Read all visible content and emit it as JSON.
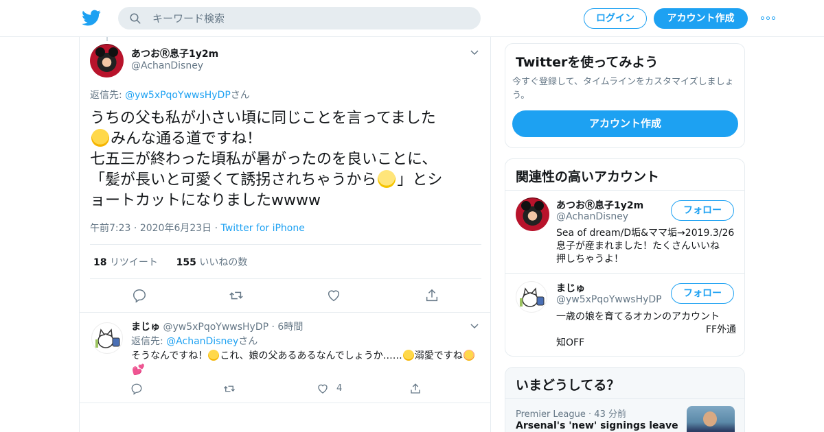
{
  "header": {
    "search_placeholder": "キーワード検索",
    "login_label": "ログイン",
    "signup_label": "アカウント作成"
  },
  "tweet": {
    "author_name": "あつおⓇ息子1y2m",
    "author_handle": "@AchanDisney",
    "reply_prefix": "返信先: ",
    "reply_to": "@yw5xPqoYwwsHyDP",
    "reply_suffix": "さん",
    "text_lines": [
      "うちの父も私が小さい頃に同じことを言ってました",
      "みんな通る道ですね！",
      "七五三が終わった頃私が暑がったのを良いことに、",
      "「髪が長いと可愛くて誘拐されちゃうから",
      "」とシ",
      "ョートカットになりましたwwww"
    ],
    "time": "午前7:23",
    "date": "2020年6月23日",
    "source": "Twitter for iPhone",
    "retweet_count": "18",
    "retweet_label": "リツイート",
    "like_count": "155",
    "like_label": "いいねの数"
  },
  "reply": {
    "author_name": "まじゅ",
    "author_handle": "@yw5xPqoYwwsHyDP",
    "time_ago": "6時間",
    "reply_prefix": "返信先: ",
    "reply_to": "@AchanDisney",
    "reply_suffix": "さん",
    "text_part1": "そうなんですね！",
    "text_part2": "これ、娘の父あるあるなんでしょうか……",
    "text_part3": "溺愛ですね",
    "like_count": "4"
  },
  "sidebar": {
    "signup_card": {
      "title": "Twitterを使ってみよう",
      "subtitle": "今すぐ登録して、タイムラインをカスタマイズしましょう。",
      "button": "アカウント作成"
    },
    "related": {
      "title": "関連性の高いアカウント",
      "accounts": [
        {
          "name": "あつおⓇ息子1y2m",
          "handle": "@AchanDisney",
          "follow": "フォロー",
          "bio_lines": [
            "Sea of dream/D垢&ママ垢→2019.3/26",
            "息子が産まれました！たくさんいいね",
            "押しちゃうよ！"
          ]
        },
        {
          "name": "まじゅ",
          "handle": "@yw5xPqoYwwsHyDP",
          "follow": "フォロー",
          "bio_lines": [
            "一歳の娘を育てるオカンのアカウント",
            "FF外通",
            "知OFF"
          ]
        }
      ]
    },
    "trends": {
      "title": "いまどうしてる？",
      "item_category": "Premier League",
      "item_time": "43 分前",
      "item_title": "Arsenal's 'new' signings leave"
    }
  },
  "colors": {
    "accent": "#1da1f2",
    "text": "#14171a",
    "muted": "#657786",
    "border": "#e6ecf0"
  }
}
